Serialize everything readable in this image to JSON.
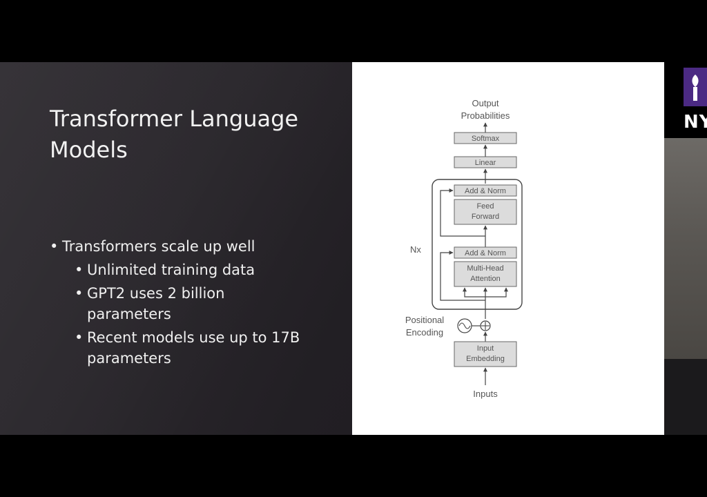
{
  "slide": {
    "title": "Transformer Language Models",
    "bullets": [
      {
        "text": "Transformers scale up well",
        "sub": [
          {
            "lines": [
              "Unlimited training data"
            ]
          },
          {
            "lines": [
              "GPT2 uses 2 billion",
              "parameters"
            ]
          },
          {
            "lines": [
              "Recent models use up to 17B",
              "parameters"
            ]
          }
        ]
      }
    ]
  },
  "diagram": {
    "output_label": [
      "Output",
      "Probabilities"
    ],
    "softmax": "Softmax",
    "linear": "Linear",
    "add_norm_top": "Add & Norm",
    "feed_forward": [
      "Feed",
      "Forward"
    ],
    "add_norm_bottom": "Add & Norm",
    "multi_head": [
      "Multi-Head",
      "Attention"
    ],
    "nx": "Nx",
    "positional": [
      "Positional",
      "Encoding"
    ],
    "input_embedding": [
      "Input",
      "Embedding"
    ],
    "inputs": "Inputs"
  },
  "logo": {
    "text": "NY"
  },
  "colors": {
    "slide_bg": "#2a272c",
    "figure_bg": "#ffffff",
    "block_fill": "#dcdcdc",
    "stroke": "#666666"
  }
}
